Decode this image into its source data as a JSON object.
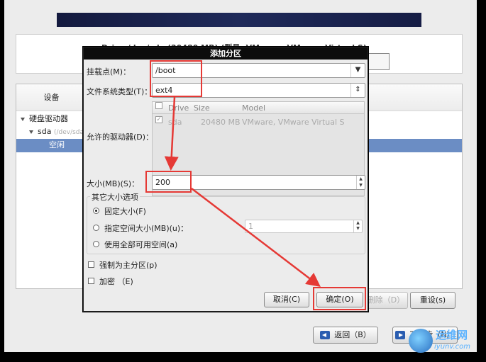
{
  "background": {
    "drive_title": "Drive /dev/sda (20480 MB) (型号: VMware, VMware Virtual S)",
    "device_header": "设备",
    "tree": {
      "hard_drives": "硬盘驱动器",
      "sda": "sda",
      "sda_path": "(/dev/sda)",
      "free": "空闲"
    },
    "buttons": {
      "delete": "删除（D）",
      "reset": "重设(s)",
      "back": "返回（B）",
      "next": "下一步（N）"
    }
  },
  "dialog": {
    "title": "添加分区",
    "mount_point": {
      "label": "挂载点(M)：",
      "value": "/boot"
    },
    "fs_type": {
      "label": "文件系统类型(T)：",
      "value": "ext4"
    },
    "allowed_drives": {
      "label": "允许的驱动器(D)：",
      "columns": [
        "Drive",
        "Size",
        "Model"
      ],
      "rows": [
        {
          "checked": true,
          "drive": "sda",
          "size": "20480 MB",
          "model": "VMware, VMware Virtual S"
        }
      ]
    },
    "size": {
      "label": "大小(MB)(S)：",
      "value": "200"
    },
    "size_options": {
      "title": "其它大小选项",
      "fixed": "固定大小(F)",
      "fill_upto": "指定空间大小(MB)(u)：",
      "fill_upto_value": "1",
      "fill_all": "使用全部可用空间(a)",
      "selected": "fixed"
    },
    "primary": "强制为主分区(p)",
    "encrypt": "加密 （E)",
    "buttons": {
      "cancel": "取消(C)",
      "ok": "确定(O)"
    }
  },
  "watermark": {
    "text": "运维网",
    "url": "iyunv.com"
  },
  "colors": {
    "annotation": "#e53935",
    "selection": "#6b8dc4",
    "banner": "#1a2350"
  }
}
